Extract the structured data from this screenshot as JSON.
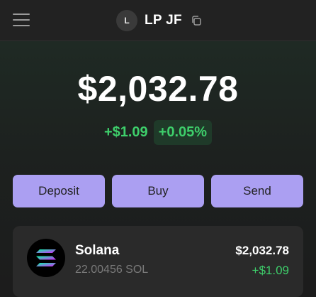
{
  "header": {
    "avatar_initial": "L",
    "account_name": "LP JF",
    "menu_icon": "hamburger-menu-icon",
    "copy_icon": "copy-icon"
  },
  "portfolio": {
    "balance": "$2,032.78",
    "change_amount": "+$1.09",
    "change_percent": "+0.05%"
  },
  "actions": [
    {
      "label": "Deposit"
    },
    {
      "label": "Buy"
    },
    {
      "label": "Send"
    }
  ],
  "tokens": [
    {
      "name": "Solana",
      "balance": "22.00456 SOL",
      "value": "$2,032.78",
      "change": "+$1.09",
      "icon": "solana-logo-icon"
    }
  ],
  "colors": {
    "accent": "#ab9ff2",
    "positive": "#3ecf6b",
    "background": "#1c1c1c",
    "card": "#2a2a2a"
  }
}
